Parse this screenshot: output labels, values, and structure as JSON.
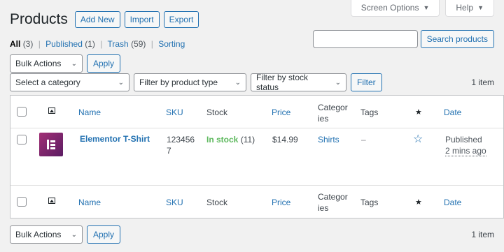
{
  "screen_meta": {
    "screen_options": "Screen Options",
    "help": "Help"
  },
  "header": {
    "title": "Products",
    "buttons": [
      "Add New",
      "Import",
      "Export"
    ]
  },
  "views": [
    {
      "label": "All",
      "count": "(3)"
    },
    {
      "label": "Published",
      "count": "(1)"
    },
    {
      "label": "Trash",
      "count": "(59)"
    },
    {
      "label": "Sorting",
      "count": ""
    }
  ],
  "search": {
    "value": "",
    "button": "Search products"
  },
  "bulk_actions": {
    "select": "Bulk Actions",
    "apply": "Apply"
  },
  "filters": {
    "category": "Select a category",
    "product_type": "Filter by product type",
    "stock_status": "Filter by stock status",
    "button": "Filter"
  },
  "items_count": "1 item",
  "columns": {
    "name": "Name",
    "sku": "SKU",
    "stock": "Stock",
    "price": "Price",
    "categories_1": "Categor",
    "categories_2": "ies",
    "tags": "Tags",
    "date": "Date"
  },
  "product": {
    "name": "Elementor T-Shirt",
    "sku_1": "123456",
    "sku_2": "7",
    "stock_status": "In stock",
    "stock_qty": "(11)",
    "price": "$14.99",
    "categories": "Shirts",
    "tags": "–",
    "date_status": "Published",
    "date_ago": "2 mins ago"
  },
  "colors": {
    "link": "#2271b1",
    "in_stock": "#5cb85c",
    "thumb": "#92003b"
  }
}
